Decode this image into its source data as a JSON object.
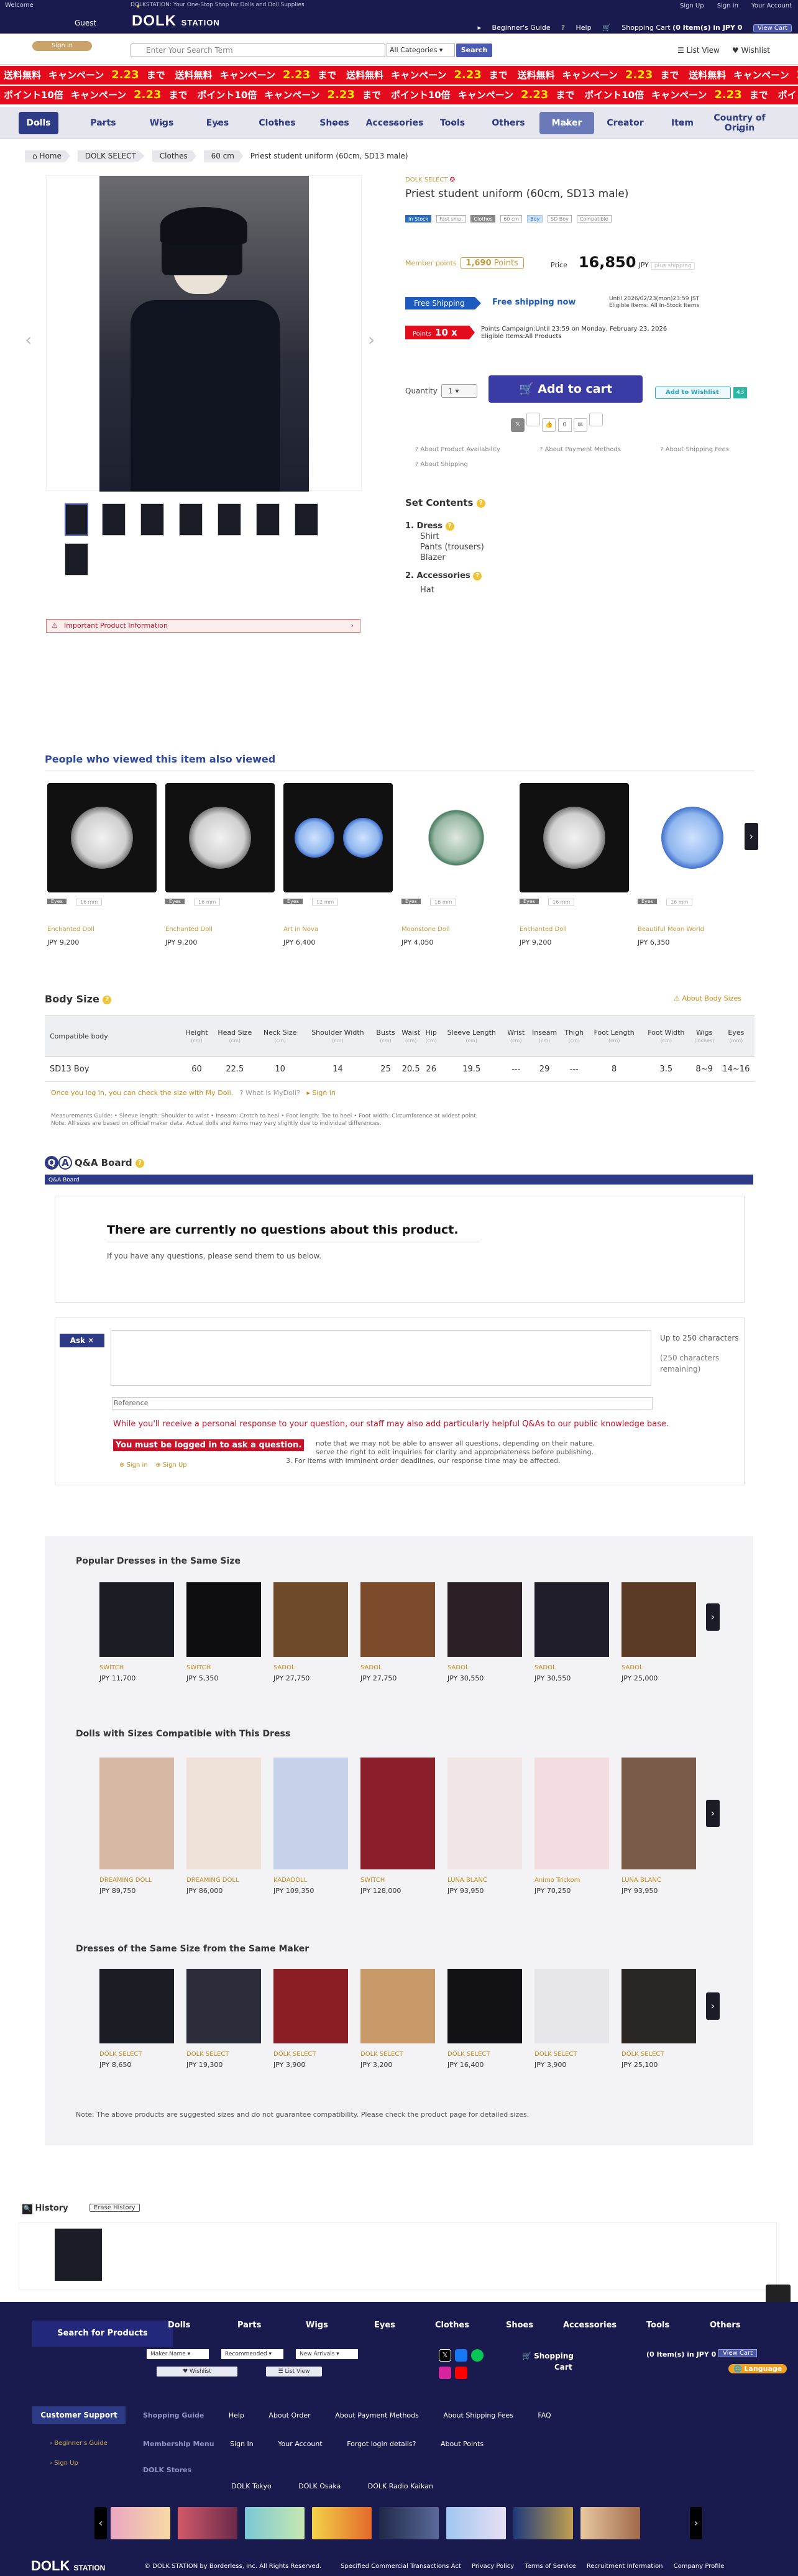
{
  "topbar": {
    "welcome": "Welcome",
    "tagline": "DOLKSTATION: Your One-Stop Shop for Dolls and Doll Supplies",
    "guest": "Guest",
    "signin": "Sign in",
    "logo": "DOLK",
    "logo_small": "STATION",
    "links": [
      "Sign Up",
      "Sign in",
      "Your Account"
    ],
    "util": [
      "Beginner's Guide",
      "Help",
      "Shopping Cart",
      "(0 Item(s) in JPY 0",
      "View Cart"
    ]
  },
  "search": {
    "placeholder": "Enter Your Search Term",
    "category": "All Categories",
    "button": "Search",
    "listview": "List View",
    "wishlist": "Wishlist"
  },
  "banners": {
    "a": "送料無料",
    "b": "キャンペーン",
    "c": "2.23",
    "d": "ポイント10倍",
    "e": "まで"
  },
  "catnav": [
    "Dolls",
    "Parts",
    "Wigs",
    "Eyes",
    "Clothes",
    "Shoes",
    "Accessories",
    "Tools",
    "Others",
    "Maker",
    "Creator",
    "Item",
    "Country of Origin"
  ],
  "breadcrumb": [
    "Home",
    "DOLK SELECT",
    "Clothes",
    "60 cm"
  ],
  "breadcrumb_current": "Priest student uniform (60cm, SD13 male)",
  "product": {
    "maker": "DOLK SELECT",
    "title": "Priest student uniform (60cm, SD13 male)",
    "tags": [
      "In Stock",
      "Fast ship.",
      "Clothes",
      "60 cm",
      "Boy",
      "SD Boy",
      "Compatible"
    ],
    "member_label": "Member points",
    "member_points": "1,690",
    "points_unit": "Points",
    "price_label": "Price",
    "price": "16,850",
    "currency": "JPY",
    "price_tag": "plus shipping",
    "free_ship": "Free Shipping",
    "free_ship_now": "Free shipping now",
    "free_ship_d1": "Until 2026/02/23(mon)23:59 JST",
    "free_ship_d2": "Eligible Items: All In-Stock Items",
    "points_tag": "Points",
    "points_x": "10 x",
    "points_d1": "Points Campaign:Until 23:59 on Monday, February 23, 2026",
    "points_d2": "Eligible Items:All Products",
    "qty_label": "Quantity",
    "qty": "1",
    "cart": "Add to cart",
    "wish": "Add to Wishlist",
    "wish_count": "43",
    "links": [
      "About Product Availability",
      "About Payment Methods",
      "About Shipping Fees"
    ],
    "links2": "About Shipping",
    "warning": "Important Product Information"
  },
  "set": {
    "title": "Set Contents",
    "groups": [
      {
        "h": "1. Dress",
        "items": [
          "Shirt",
          "Pants (trousers)",
          "Blazer"
        ]
      },
      {
        "h": "2. Accessories",
        "items": [
          "Hat"
        ]
      }
    ]
  },
  "alsoviewed": {
    "title": "People who viewed this item also viewed",
    "items": [
      {
        "tag": "Eyes",
        "size": "16 mm",
        "maker": "Enchanted Doll",
        "price": "JPY 9,200"
      },
      {
        "tag": "Eyes",
        "size": "16 mm",
        "maker": "Enchanted Doll",
        "price": "JPY 9,200"
      },
      {
        "tag": "Eyes",
        "size": "12 mm",
        "maker": "Art in Nova",
        "price": "JPY 6,400"
      },
      {
        "tag": "Eyes",
        "size": "16 mm",
        "maker": "Moonstone Doll",
        "price": "JPY 4,050"
      },
      {
        "tag": "Eyes",
        "size": "16 mm",
        "maker": "Enchanted Doll",
        "price": "JPY 9,200"
      },
      {
        "tag": "Eyes",
        "size": "16 mm",
        "maker": "Beautiful Moon World",
        "price": "JPY 6,350"
      }
    ]
  },
  "bodysize": {
    "title": "Body Size",
    "link": "About Body Sizes",
    "cols": [
      "Compatible body",
      "Height",
      "Head Size",
      "Neck Size",
      "Shoulder Width",
      "Busts",
      "Waist",
      "Hip",
      "Sleeve Length",
      "Wrist",
      "Inseam",
      "Thigh",
      "Foot Length",
      "Foot Width",
      "Wigs",
      "Eyes"
    ],
    "units": [
      "",
      "(cm)",
      "(cm)",
      "(cm)",
      "(cm)",
      "(cm)",
      "(cm)",
      "(cm)",
      "(cm)",
      "(cm)",
      "(cm)",
      "(cm)",
      "(cm)",
      "(cm)",
      "(inches)",
      "(mm)"
    ],
    "row": [
      "SD13 Boy",
      "60",
      "22.5",
      "10",
      "14",
      "25",
      "20.5",
      "26",
      "19.5",
      "---",
      "29",
      "---",
      "8",
      "3.5",
      "8~9",
      "14~16"
    ],
    "note1": "Once you log in, you can check the size with My Doll.",
    "note1b": "What is MyDoll?",
    "note1c": "Sign in",
    "note2": "Measurements Guide: • Sleeve length: Shoulder to wrist • Inseam: Crotch to heel • Foot length: Toe to heel • Foot width: Circumference at widest point.",
    "note3": "Note: All sizes are based on official maker data. Actual dolls and items may vary slightly due to individual differences."
  },
  "qa": {
    "title": "Q&A Board",
    "bar": "Q&A Board",
    "empty": "There are currently no questions about this product.",
    "empty2": "If you have any questions, please send them to us below.",
    "ask": "Ask",
    "counter": "Up to 250 characters",
    "remaining": "(250 characters remaining)",
    "ref": "Reference",
    "red": "While you'll receive a personal response to your question, our staff may also add particularly helpful Q&As to our public knowledge base.",
    "login": "You must be logged in to ask a question.",
    "small1": "note that we may not be able to answer all questions, depending on their nature.",
    "small2": "serve the right to edit inquiries for clarity and appropriateness before publishing.",
    "small3": "3. For items with imminent order deadlines, our response time may be affected.",
    "signin": "Sign in",
    "signup": "Sign Up"
  },
  "sugg": {
    "h1": "Popular Dresses in the Same Size",
    "h2": "Dolls with Sizes Compatible with This Dress",
    "h3": "Dresses of the Same Size from the Same Maker",
    "r1": [
      {
        "m": "SWITCH",
        "p": "JPY 11,700"
      },
      {
        "m": "SWITCH",
        "p": "JPY 5,350"
      },
      {
        "m": "SADOL",
        "p": "JPY 27,750"
      },
      {
        "m": "SADOL",
        "p": "JPY 27,750"
      },
      {
        "m": "SADOL",
        "p": "JPY 30,550"
      },
      {
        "m": "SADOL",
        "p": "JPY 30,550"
      },
      {
        "m": "SADOL",
        "p": "JPY 25,000"
      }
    ],
    "r2": [
      {
        "m": "DREAMING DOLL",
        "p": "JPY 89,750"
      },
      {
        "m": "DREAMING DOLL",
        "p": "JPY 86,000"
      },
      {
        "m": "KADADOLL",
        "p": "JPY 109,350"
      },
      {
        "m": "SWITCH",
        "p": "JPY 128,000"
      },
      {
        "m": "LUNA BLANC",
        "p": "JPY 93,950"
      },
      {
        "m": "Animo Trickom",
        "p": "JPY 70,250"
      },
      {
        "m": "LUNA BLANC",
        "p": "JPY 93,950"
      }
    ],
    "r3": [
      {
        "m": "DOLK SELECT",
        "p": "JPY 8,650"
      },
      {
        "m": "DOLK SELECT",
        "p": "JPY 19,300"
      },
      {
        "m": "DOLK SELECT",
        "p": "JPY 3,900"
      },
      {
        "m": "DOLK SELECT",
        "p": "JPY 3,200"
      },
      {
        "m": "DOLK SELECT",
        "p": "JPY 16,400"
      },
      {
        "m": "DOLK SELECT",
        "p": "JPY 3,900"
      },
      {
        "m": "DOLK SELECT",
        "p": "JPY 25,100"
      }
    ],
    "note": "Note: The above products are suggested sizes and do not guarantee compatibility. Please check the product page for detailed sizes."
  },
  "history": {
    "title": "History",
    "erase": "Erase History"
  },
  "pagetop": "PAGE TOP",
  "footer": {
    "sp": "Search for Products",
    "cats": [
      "Dolls",
      "Parts",
      "Wigs",
      "Eyes",
      "Clothes",
      "Shoes",
      "Accessories",
      "Tools",
      "Others"
    ],
    "sel1": "Maker Name",
    "sel2": "Recommended",
    "sel3": "New Arrivals",
    "wish": "Wishlist",
    "listview": "List View",
    "cart": "Shopping",
    "cart2": "Cart",
    "cartr": "(0 Item(s) in JPY 0",
    "viewcart": "View Cart",
    "lang": "Language",
    "cs": "Customer Support",
    "r1": [
      "Shopping Guide",
      "Help",
      "About Order",
      "About Payment Methods",
      "About Shipping Fees",
      "FAQ"
    ],
    "r2": [
      "Membership Menu",
      "Sign In",
      "Your Account",
      "Forgot login details?",
      "About Points"
    ],
    "r3": [
      "DOLK Stores",
      "DOLK Tokyo",
      "DOLK Osaka",
      "DOLK Radio Kaikan"
    ],
    "side": [
      "Beginner's Guide",
      "Sign Up"
    ],
    "logo": "DOLK",
    "logo_small": "STATION",
    "copy": "© DOLK STATION by Borderless, Inc. All Rights Reserved.",
    "bottom": [
      "Specified Commercial Transactions Act",
      "Privacy Policy",
      "Terms of Service",
      "Recruitment Information",
      "Company Profile"
    ]
  }
}
